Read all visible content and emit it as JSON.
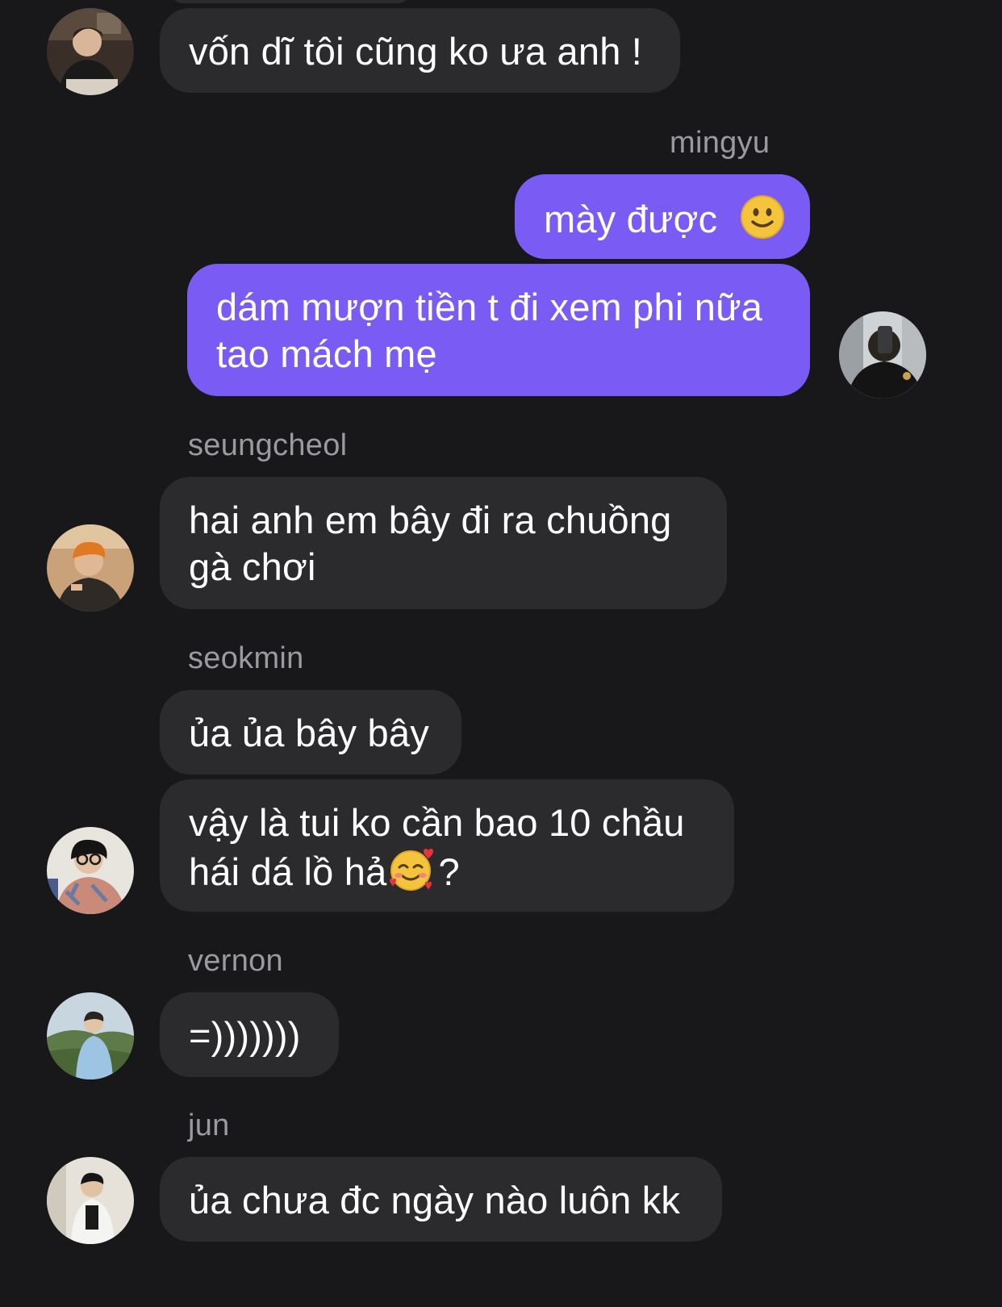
{
  "messages": [
    {
      "sender": "",
      "text_lines": [
        "vốn dĩ tôi cũng ko ưa anh !"
      ]
    },
    {
      "sender": "mingyu",
      "text_lines": [
        "mày được"
      ],
      "emoji": "slightly-smiling-face"
    },
    {
      "sender": "mingyu",
      "text_lines": [
        "dám mượn tiền t đi xem phi nữa",
        "tao mách mẹ"
      ]
    },
    {
      "sender": "seungcheol",
      "text_lines": [
        "hai anh em bây đi ra chuồng",
        "gà chơi"
      ]
    },
    {
      "sender": "seokmin",
      "text_lines": [
        "ủa ủa bây bây"
      ]
    },
    {
      "sender": "seokmin",
      "text_lines": [
        "vậy là tui ko cần bao 10 chầu",
        "hái dá lồ hả"
      ],
      "suffix": "?",
      "emoji": "smiling-face-with-hearts"
    },
    {
      "sender": "vernon",
      "text_lines": [
        "=)))))))"
      ]
    },
    {
      "sender": "jun",
      "text_lines": [
        "ủa chưa đc ngày nào luôn kk"
      ]
    }
  ],
  "senders": {
    "mingyu": "mingyu",
    "seungcheol": "seungcheol",
    "seokmin": "seokmin",
    "vernon": "vernon",
    "jun": "jun"
  },
  "colors": {
    "background": "#18181a",
    "incoming_bubble": "#2b2b2e",
    "outgoing_bubble": "#7a5cf5",
    "sender_name": "#9a9a9f"
  }
}
